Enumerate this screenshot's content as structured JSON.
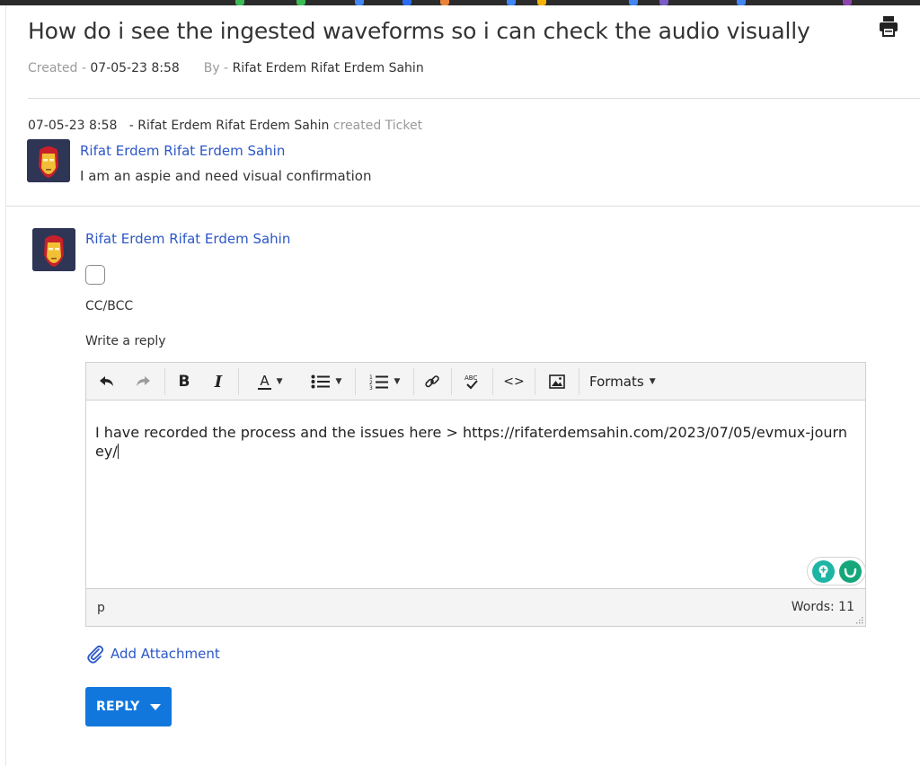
{
  "ticket": {
    "title": "How do i see the ingested waveforms so i can check the audio visually",
    "created_label": "Created -",
    "created_value": "07-05-23 8:58",
    "by_label": "By -",
    "by_value": "Rifat Erdem Rifat Erdem Sahin"
  },
  "activity": {
    "timestamp": "07-05-23 8:58",
    "actor": "- Rifat Erdem Rifat Erdem Sahin",
    "action": "created Ticket",
    "author": "Rifat Erdem Rifat Erdem Sahin",
    "message": "I am an aspie and need visual confirmation"
  },
  "reply": {
    "author": "Rifat Erdem Rifat Erdem Sahin",
    "cc_label": "CC/BCC",
    "write_label": "Write a reply",
    "formats_label": "Formats",
    "content": "I have recorded the process and the issues here > https://rifaterdemsahin.com/2023/07/05/evmux-journey/",
    "status_path": "p",
    "word_count": "Words: 11",
    "attachment_label": "Add Attachment",
    "reply_button": "REPLY"
  },
  "colors": {
    "link": "#2c57c7",
    "reply_button": "#1177dd",
    "badge_teal": "#1fb5a4",
    "badge_green": "#15a77a"
  },
  "icons": [
    "print-icon",
    "undo-icon",
    "redo-icon",
    "bold-icon",
    "italic-icon",
    "text-color-icon",
    "bullet-list-icon",
    "numbered-list-icon",
    "link-icon",
    "spellcheck-icon",
    "code-icon",
    "image-icon",
    "bulb-icon",
    "grammarly-icon",
    "paperclip-icon"
  ]
}
